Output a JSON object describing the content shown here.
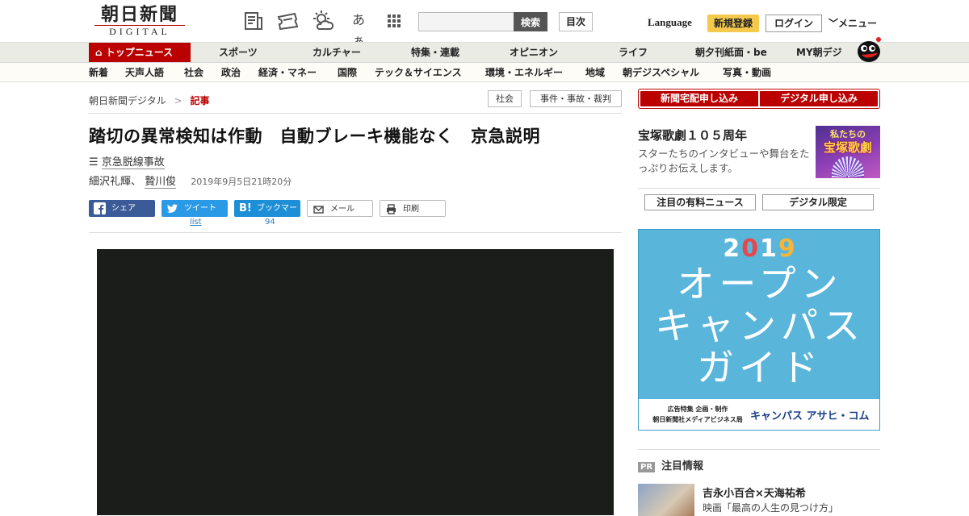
{
  "header": {
    "logo_jp": "朝日新聞",
    "logo_en": "DIGITAL",
    "font_size_glyph": "あぁ",
    "search_placeholder": "",
    "search_button": "検索",
    "toc_button": "目次",
    "language": "Language",
    "register": "新規登録",
    "login": "ログイン",
    "menu": "メニュー"
  },
  "nav_primary": [
    "トップニュース",
    "スポーツ",
    "カルチャー",
    "特集・連載",
    "オピニオン",
    "ライフ",
    "朝夕刊紙面・be",
    "MY朝デジ"
  ],
  "nav_secondary": [
    "新着",
    "天声人語",
    "社会",
    "政治",
    "経済・マネー",
    "国際",
    "テック＆サイエンス",
    "環境・エネルギー",
    "地域",
    "朝デジスペシャル",
    "写真・動画"
  ],
  "breadcrumb": {
    "home": "朝日新聞デジタル",
    "sep": ">",
    "current": "記事"
  },
  "tags": [
    "社会",
    "事件・事故・裁判"
  ],
  "article": {
    "headline": "踏切の異常検知は作動　自動ブレーキ機能なく　京急説明",
    "series": "京急脱線事故",
    "author1": "細沢礼輝、",
    "author2": "贄川俊",
    "date": "2019年9月5日21時20分"
  },
  "share": {
    "facebook": "シェア",
    "twitter": "ツイート",
    "twitter_count": "list",
    "hatena": "ブックマーク",
    "hatena_count": "94",
    "mail": "メール",
    "print": "印刷"
  },
  "sidebar": {
    "subscribe_paper": "新聞宅配申し込み",
    "subscribe_digital": "デジタル申し込み",
    "promo_title": "宝塚歌劇１０５周年",
    "promo_text": "スターたちのインタビューや舞台をたっぷりお伝えします。",
    "promo_img_line1": "私たちの",
    "promo_img_line2": "宝塚歌劇",
    "tab_paid": "注目の有料ニュース",
    "tab_digital": "デジタル限定",
    "ad_year": [
      "2",
      "0",
      "1",
      "9"
    ],
    "ad_line1": "オープン",
    "ad_line2": "キャンパス",
    "ad_line3": "ガイド",
    "ad_foot_line1": "広告特集 企画・制作",
    "ad_foot_line2": "朝日新聞社メディアビジネス局",
    "ad_foot_brand": "キャンパス アサヒ・コム",
    "pr_badge": "PR",
    "pr_heading": "注目情報",
    "pr_title": "吉永小百合×天海祐希",
    "pr_sub": "映画「最高の人生の見つけ方」"
  },
  "colors": {
    "brand_red": "#bb0000",
    "ad_blue": "#59b6da",
    "register_yellow": "#f5c94b"
  },
  "icons": [
    "newspaper-icon",
    "ticket-icon",
    "weather-icon",
    "font-size-icon",
    "apps-grid-icon",
    "home-icon",
    "facebook-icon",
    "twitter-icon",
    "hatena-icon",
    "mail-icon",
    "print-icon",
    "list-icon",
    "chevron-down-icon"
  ]
}
